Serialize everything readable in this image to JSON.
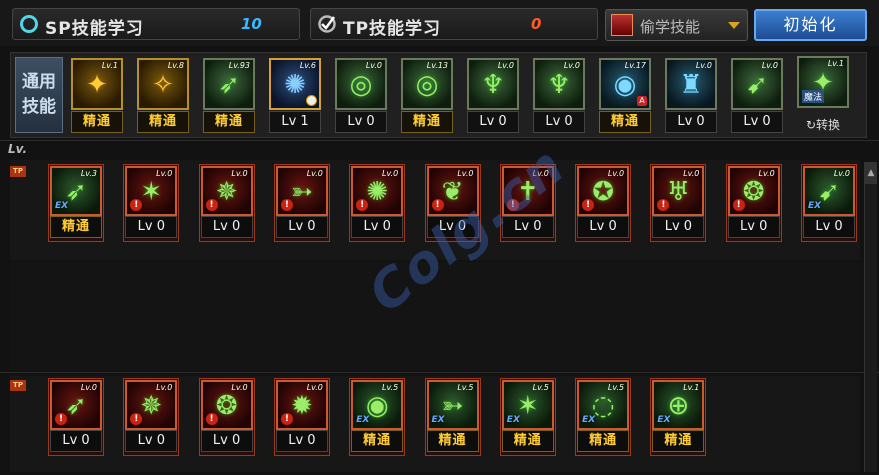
{
  "header": {
    "sp_title": "SP技能学习",
    "sp_value": "10",
    "tp_title": "TP技能学习",
    "tp_value": "0",
    "steal_label": "偷学技能",
    "reset_label": "初始化"
  },
  "general_skills": {
    "category_label": "通用技能",
    "items": [
      {
        "lv": "Lv.1",
        "status": "精通",
        "style": "y",
        "glyph": "✦"
      },
      {
        "lv": "Lv.8",
        "status": "精通",
        "style": "y",
        "glyph": "✧"
      },
      {
        "lv": "Lv.93",
        "status": "精通",
        "style": "g",
        "glyph": "➶"
      },
      {
        "lv": "Lv.6",
        "status": "Lv 1",
        "style": "b",
        "glyph": "✺"
      },
      {
        "lv": "Lv.0",
        "status": "Lv 0",
        "style": "g",
        "glyph": "◎"
      },
      {
        "lv": "Lv.13",
        "status": "精通",
        "style": "g",
        "glyph": "◎"
      },
      {
        "lv": "Lv.0",
        "status": "Lv 0",
        "style": "g",
        "glyph": "♆"
      },
      {
        "lv": "Lv.0",
        "status": "Lv 0",
        "style": "g",
        "glyph": "♆"
      },
      {
        "lv": "Lv.17",
        "status": "精通",
        "style": "t",
        "glyph": "◉"
      },
      {
        "lv": "Lv.0",
        "status": "Lv 0",
        "style": "t",
        "glyph": "♜"
      },
      {
        "lv": "Lv.0",
        "status": "Lv 0",
        "style": "g",
        "glyph": "➹"
      }
    ],
    "convert_skill": {
      "lv": "Lv.1",
      "tag": "魔法",
      "label": "转换"
    }
  },
  "job_section_label": "Lv.",
  "tp_tag": "TP",
  "job_row_1": [
    {
      "lv": "Lv.3",
      "status": "精通",
      "style": "rg",
      "badge": "ex",
      "glyph": "➶"
    },
    {
      "lv": "Lv.0",
      "status": "Lv 0",
      "style": "r",
      "badge": "lock",
      "glyph": "✶"
    },
    {
      "lv": "Lv.0",
      "status": "Lv 0",
      "style": "r",
      "badge": "lock",
      "glyph": "✵"
    },
    {
      "lv": "Lv.0",
      "status": "Lv 0",
      "style": "r",
      "badge": "lock",
      "glyph": "➳"
    },
    {
      "lv": "Lv.0",
      "status": "Lv 0",
      "style": "r",
      "badge": "lock",
      "glyph": "✺"
    },
    {
      "lv": "Lv.0",
      "status": "Lv 0",
      "style": "r",
      "badge": "lock",
      "glyph": "❦"
    },
    {
      "lv": "Lv.0",
      "status": "Lv 0",
      "style": "r",
      "badge": "lock",
      "glyph": "✝"
    },
    {
      "lv": "Lv.0",
      "status": "Lv 0",
      "style": "r",
      "badge": "lock",
      "glyph": "✪"
    },
    {
      "lv": "Lv.0",
      "status": "Lv 0",
      "style": "r",
      "badge": "lock",
      "glyph": "♅"
    },
    {
      "lv": "Lv.0",
      "status": "Lv 0",
      "style": "r",
      "badge": "lock",
      "glyph": "❂"
    },
    {
      "lv": "Lv.0",
      "status": "Lv 0",
      "style": "rg",
      "badge": "ex",
      "glyph": "➹"
    }
  ],
  "job_row_2": [
    {
      "lv": "Lv.0",
      "status": "Lv 0",
      "style": "r",
      "badge": "lock",
      "glyph": "➶"
    },
    {
      "lv": "Lv.0",
      "status": "Lv 0",
      "style": "r",
      "badge": "lock",
      "glyph": "✵"
    },
    {
      "lv": "Lv.0",
      "status": "Lv 0",
      "style": "r",
      "badge": "lock",
      "glyph": "❂"
    },
    {
      "lv": "Lv.0",
      "status": "Lv 0",
      "style": "r",
      "badge": "lock",
      "glyph": "✹"
    },
    {
      "lv": "Lv.5",
      "status": "精通",
      "style": "rg",
      "badge": "ex",
      "glyph": "◉"
    },
    {
      "lv": "Lv.5",
      "status": "精通",
      "style": "rg",
      "badge": "ex",
      "glyph": "➳"
    },
    {
      "lv": "Lv.5",
      "status": "精通",
      "style": "rg",
      "badge": "ex",
      "glyph": "✶"
    },
    {
      "lv": "Lv.5",
      "status": "精通",
      "style": "rg",
      "badge": "ex",
      "glyph": "◌"
    },
    {
      "lv": "Lv.1",
      "status": "精通",
      "style": "rg",
      "badge": "ex",
      "glyph": "⊕"
    }
  ],
  "badges": {
    "ex": "EX",
    "lock": "!",
    "a": "A"
  },
  "watermark": "Colg.cn",
  "colors": {
    "sp_value": "#39b8ff",
    "tp_value": "#ff5a2a",
    "mastered": "#ffcc33"
  }
}
